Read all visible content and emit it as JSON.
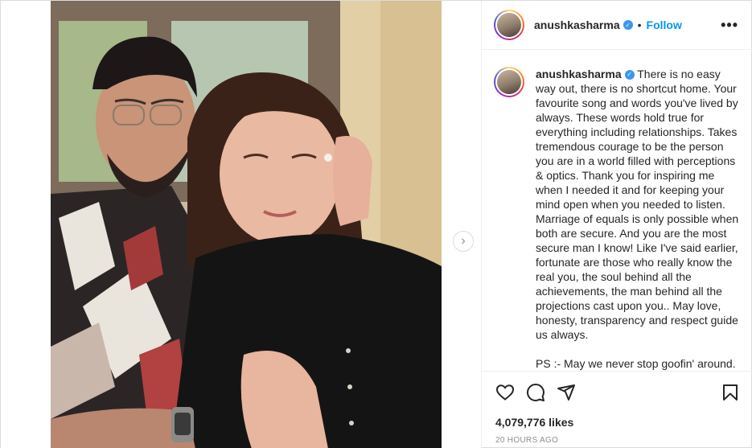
{
  "post": {
    "username": "anushkasharma",
    "follow_label": "Follow",
    "more_label": "•••",
    "caption": "There is no easy way out, there is no shortcut home. Your favourite song and words you've lived by always. These words hold true for everything including relationships. Takes tremendous courage to be the person you are in a world filled with perceptions & optics. Thank you for inspiring me when I needed it and for keeping your mind open when you needed to listen. Marriage of equals is only possible when both are secure. And you are the most secure man I know! Like I've said earlier, fortunate are those who really know the real you, the soul behind all the achievements, the man behind all the projections cast upon you.. May love, honesty, transparency and respect guide us always.",
    "caption_ps": "PS :- May we never stop goofin' around. I",
    "likes": "4,079,776 likes",
    "timestamp": "20 HOURS AGO"
  },
  "icons": {
    "verified": "verified-badge",
    "like": "heart-icon",
    "comment": "comment-icon",
    "share": "share-icon",
    "save": "bookmark-icon",
    "next": "chevron-right-icon"
  },
  "colors": {
    "link": "#0095f6",
    "verified": "#3897f0",
    "muted": "#8e8e8e",
    "border": "#dbdbdb"
  }
}
